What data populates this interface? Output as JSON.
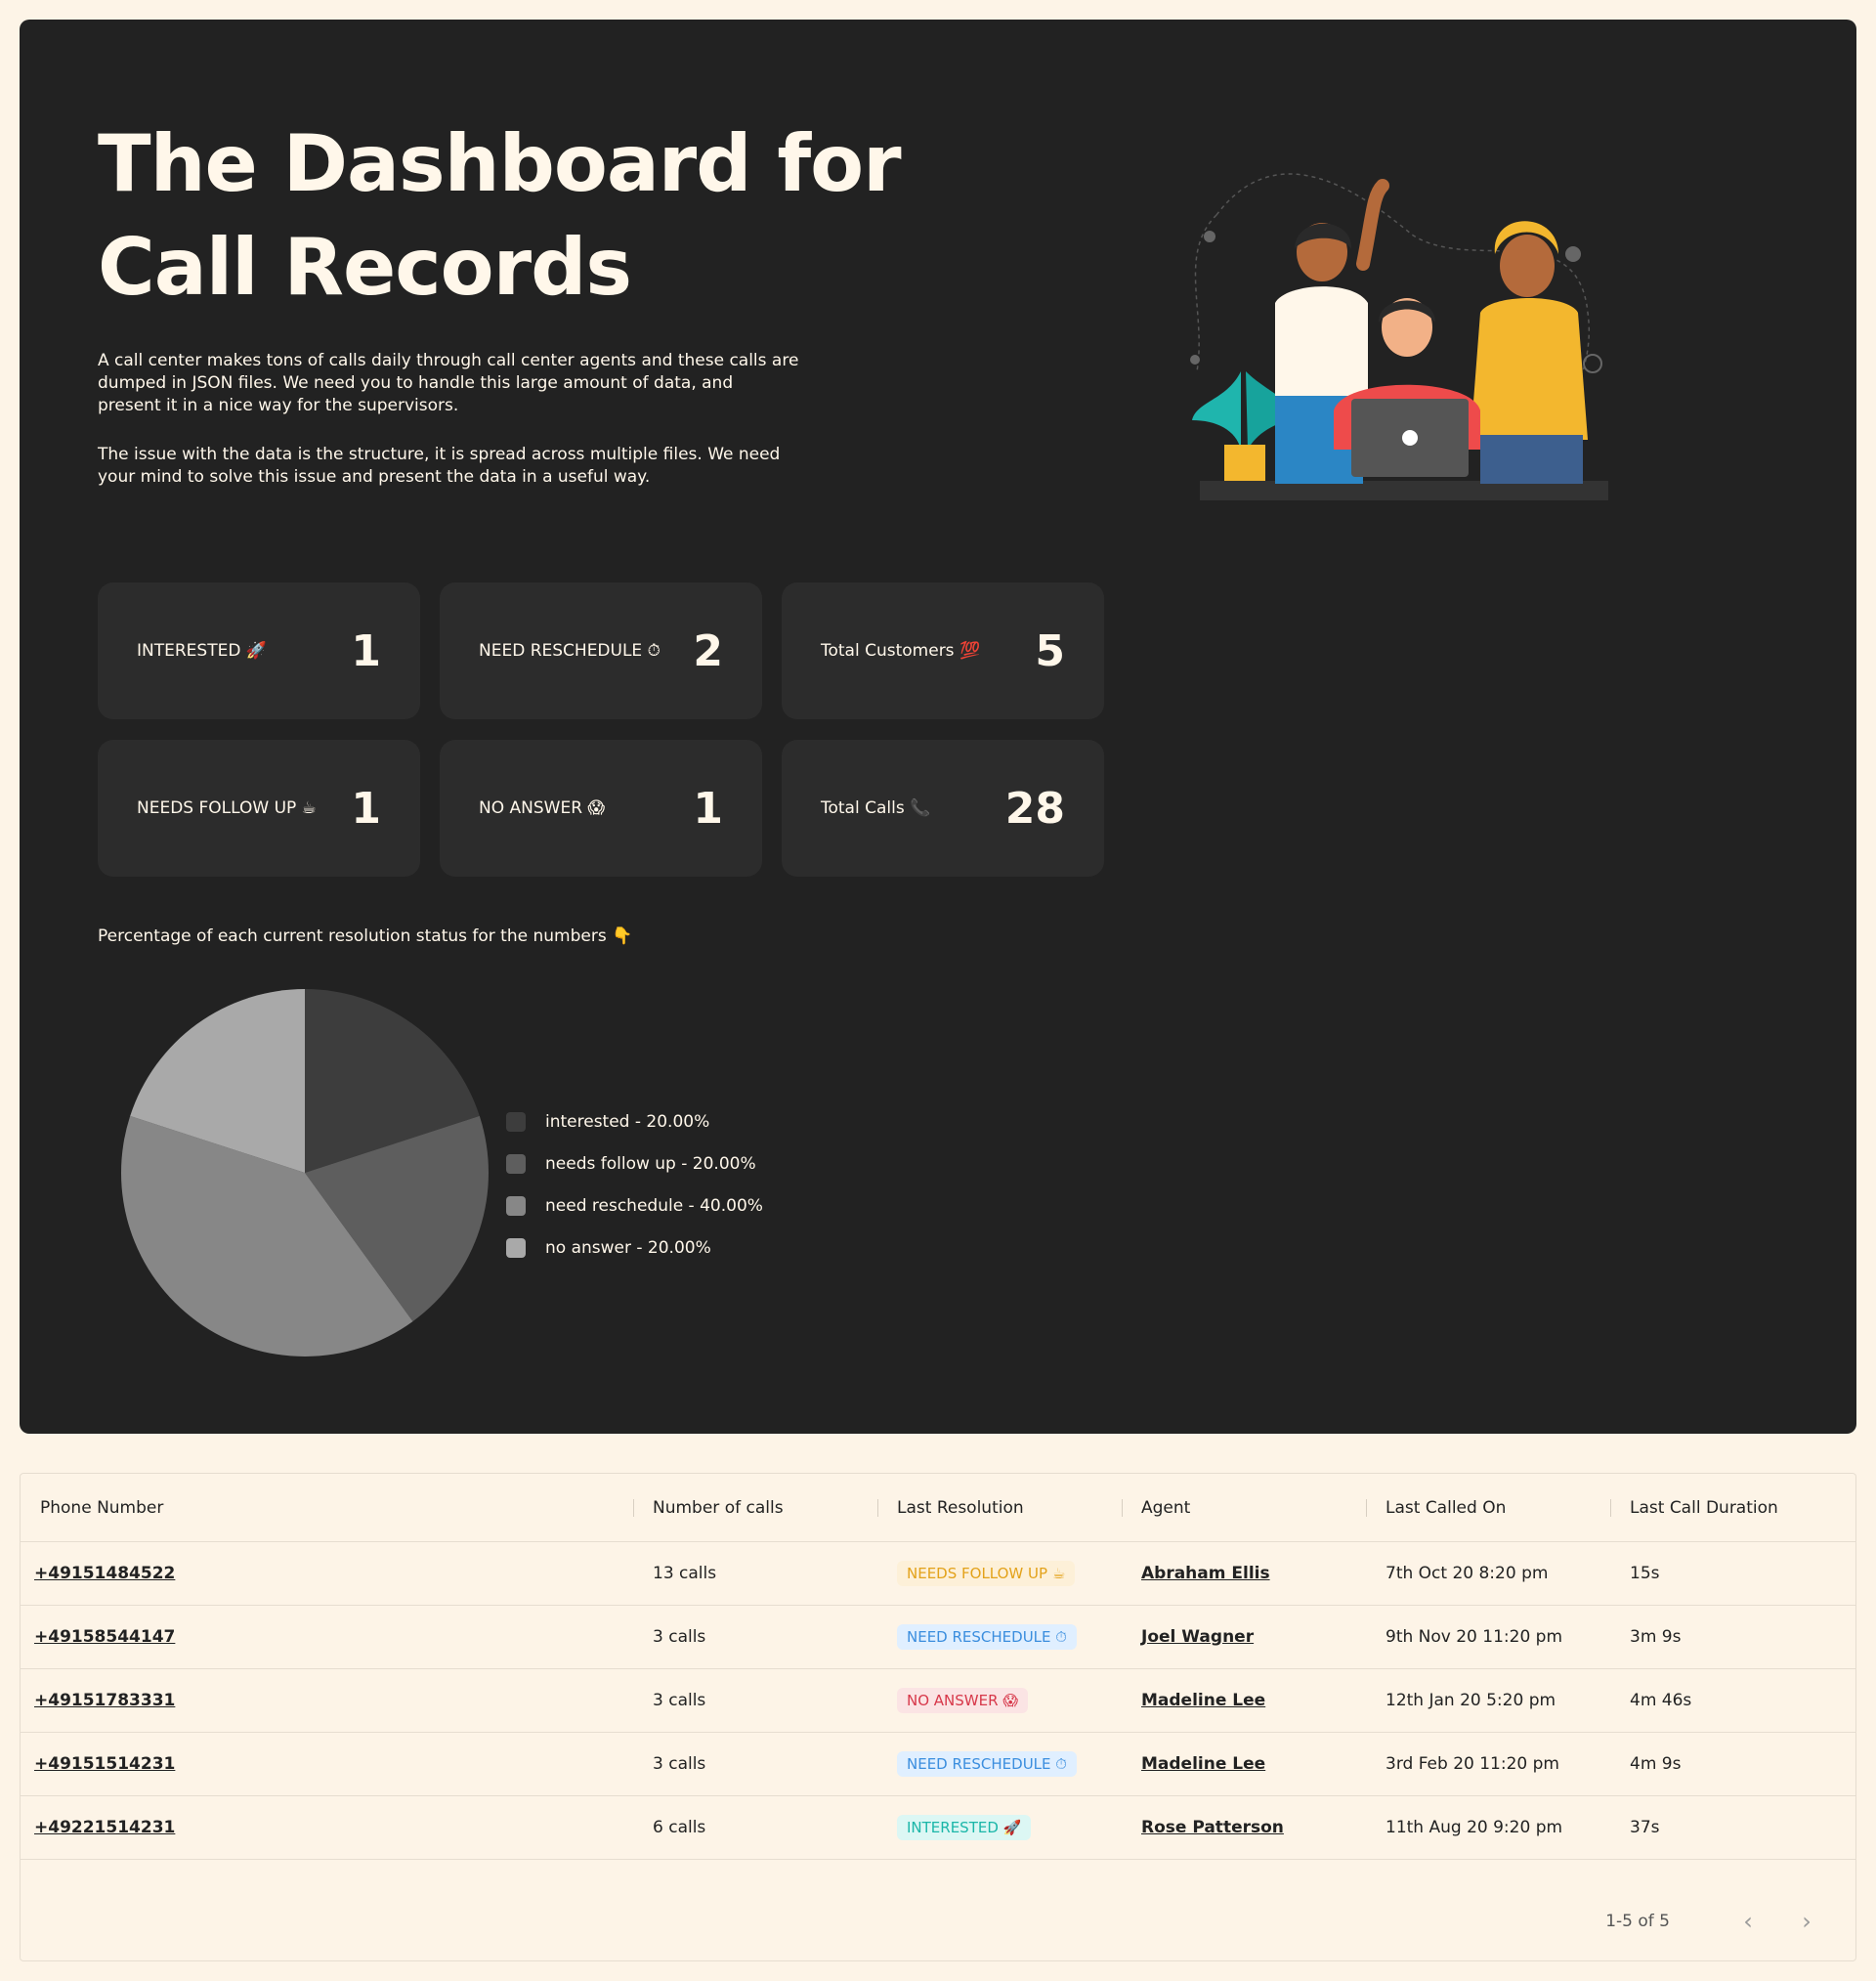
{
  "header": {
    "title_line1": "The Dashboard for",
    "title_line2": "Call Records",
    "desc1": "A call center makes tons of calls daily through call center agents and these calls are dumped in JSON files. We need you to handle this large amount of data, and present it in a nice way for the supervisors.",
    "desc2": "The issue with the data is the structure, it is spread across multiple files. We need your mind to solve this issue and present the data in a useful way."
  },
  "cards": [
    {
      "label": "INTERESTED 🚀",
      "value": "1"
    },
    {
      "label": "NEED RESCHEDULE ⏱",
      "value": "2"
    },
    {
      "label": "Total Customers 💯",
      "value": "5"
    },
    {
      "label": "NEEDS FOLLOW UP ☕",
      "value": "1"
    },
    {
      "label": "NO ANSWER 😱",
      "value": "1"
    },
    {
      "label": "Total Calls 📞",
      "value": "28"
    }
  ],
  "pie_caption": "Percentage of each current resolution status for the numbers 👇",
  "chart_data": {
    "type": "pie",
    "series": [
      {
        "name": "interested - 20.00%",
        "value": 20,
        "color": "#3d3d3d"
      },
      {
        "name": "needs follow up - 20.00%",
        "value": 20,
        "color": "#5e5e5e"
      },
      {
        "name": "need reschedule - 40.00%",
        "value": 40,
        "color": "#878787"
      },
      {
        "name": "no answer - 20.00%",
        "value": 20,
        "color": "#a9a9a9"
      }
    ]
  },
  "table": {
    "headers": [
      "Phone Number",
      "Number of calls",
      "Last Resolution",
      "Agent",
      "Last Called On",
      "Last Call Duration"
    ],
    "rows": [
      {
        "phone": "+49151484522",
        "calls": "13 calls",
        "resolution": "NEEDS FOLLOW UP ☕",
        "res_type": "follow",
        "agent": "Abraham Ellis",
        "last_called": "7th Oct 20 8:20 pm",
        "duration": "15s"
      },
      {
        "phone": "+49158544147",
        "calls": "3 calls",
        "resolution": "NEED RESCHEDULE ⏱",
        "res_type": "resched",
        "agent": "Joel Wagner",
        "last_called": "9th Nov 20 11:20 pm",
        "duration": "3m 9s"
      },
      {
        "phone": "+49151783331",
        "calls": "3 calls",
        "resolution": "NO ANSWER 😱",
        "res_type": "noans",
        "agent": "Madeline Lee",
        "last_called": "12th Jan 20 5:20 pm",
        "duration": "4m 46s"
      },
      {
        "phone": "+49151514231",
        "calls": "3 calls",
        "resolution": "NEED RESCHEDULE ⏱",
        "res_type": "resched",
        "agent": "Madeline Lee",
        "last_called": "3rd Feb 20 11:20 pm",
        "duration": "4m 9s"
      },
      {
        "phone": "+49221514231",
        "calls": "6 calls",
        "resolution": "INTERESTED 🚀",
        "res_type": "int",
        "agent": "Rose Patterson",
        "last_called": "11th Aug 20 9:20 pm",
        "duration": "37s"
      }
    ],
    "pagination": "1-5 of 5"
  }
}
